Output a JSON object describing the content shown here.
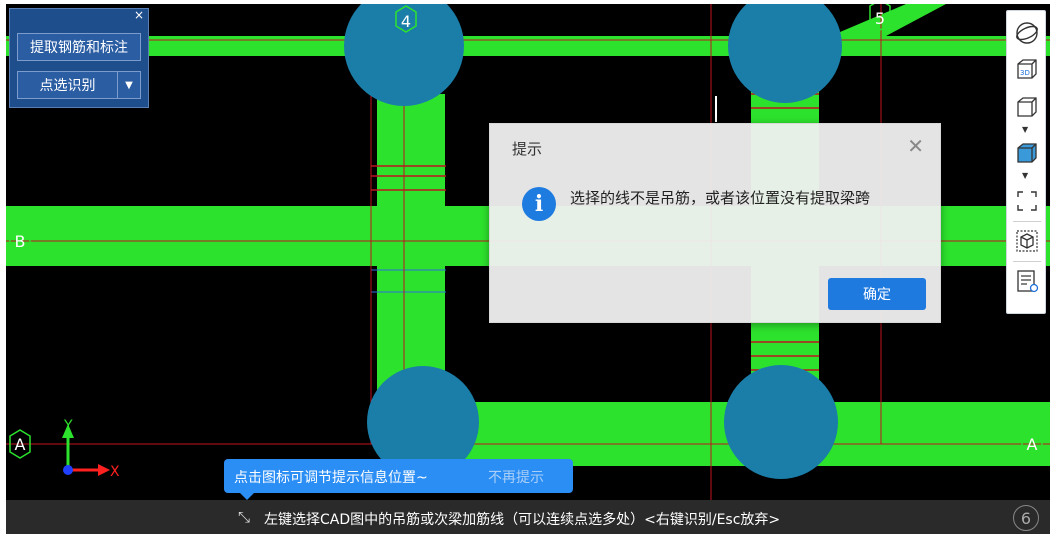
{
  "tool_panel": {
    "close_label": "×",
    "extract_button_label": "提取钢筋和标注",
    "pick_button_label": "点选识别",
    "pick_dropdown_arrow": "▼"
  },
  "drawing": {
    "axis_labels": {
      "top_4": "4",
      "top_5": "5",
      "left_B": "B",
      "left_A": "A",
      "right_A": "A",
      "bottom_6": "6"
    },
    "coord_labels": {
      "x": "X",
      "y": "Y"
    },
    "colors": {
      "background": "#000000",
      "beam": "#2de22d",
      "column": "#1a7ea8",
      "grid_line": "#c0141e",
      "axis_circle": "#2de22d"
    }
  },
  "right_toolbar": {
    "icons": [
      "orbit-icon",
      "3d-view-icon",
      "box-view-icon",
      "box-solid-icon",
      "zoom-extent-icon",
      "cube-select-icon",
      "layer-list-icon"
    ],
    "dropdown_arrow": "▼"
  },
  "dialog": {
    "title": "提示",
    "close_label": "✕",
    "icon_glyph": "i",
    "message": "选择的线不是吊筋，或者该位置没有提取梁跨",
    "ok_label": "确定"
  },
  "tooltip": {
    "text": "点击图标可调节提示信息位置~",
    "dismiss_label": "不再提示"
  },
  "status_bar": {
    "icon_glyph": "⤡",
    "text": "左键选择CAD图中的吊筋或次梁加筋线（可以连续点选多处）<右键识别/Esc放弃>"
  }
}
